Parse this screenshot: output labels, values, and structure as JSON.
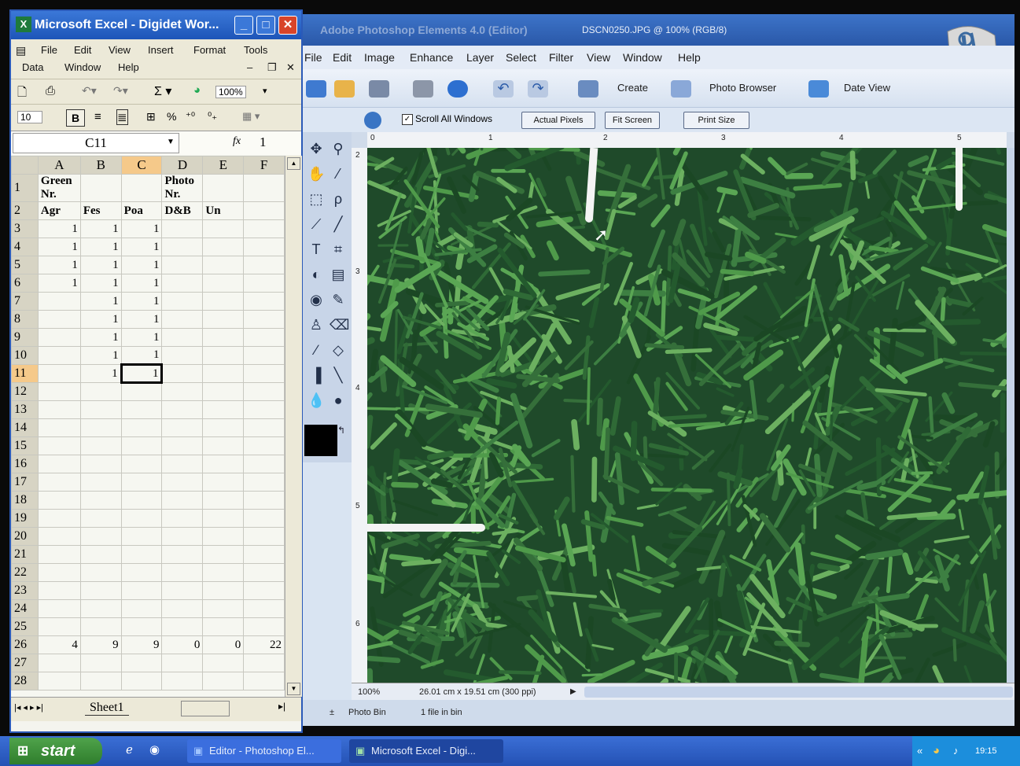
{
  "photoshop": {
    "title": "Adobe Photoshop Elements 4.0 (Editor)",
    "document_title": "DSCN0250.JPG @ 100% (RGB/8)",
    "menu": [
      "File",
      "Edit",
      "Image",
      "Enhance",
      "Layer",
      "Select",
      "Filter",
      "View",
      "Window",
      "Help"
    ],
    "toolbar": {
      "create_label": "Create",
      "photo_browser_label": "Photo Browser",
      "date_view_label": "Date View"
    },
    "options": {
      "scroll_all_label": "Scroll All Windows",
      "actual_pixels_label": "Actual Pixels",
      "fit_screen_label": "Fit Screen",
      "print_size_label": "Print Size"
    },
    "ruler_top": [
      "0",
      "1",
      "2",
      "3",
      "4",
      "5"
    ],
    "ruler_left": [
      "2",
      "3",
      "4",
      "5",
      "6"
    ],
    "status": {
      "zoom": "100%",
      "doc_size": "26.01 cm x 19.51 cm (300 ppi)"
    },
    "photo_bin": {
      "label": "Photo Bin",
      "info": "1 file in bin"
    }
  },
  "excel": {
    "title": "Microsoft Excel - Digidet Wor...",
    "menu_row1": [
      "File",
      "Edit",
      "View",
      "Insert",
      "Format",
      "Tools"
    ],
    "menu_row2": [
      "Data",
      "Window",
      "Help"
    ],
    "zoom": "100%",
    "font_size": "10",
    "name_box": "C11",
    "fx_label": "fx",
    "formula_value": "1",
    "columns": [
      "A",
      "B",
      "C",
      "D",
      "E",
      "F"
    ],
    "rows": [
      [
        "1",
        "Green Nr.",
        "",
        "",
        "Photo Nr.",
        "",
        ""
      ],
      [
        "2",
        "Agr",
        "Fes",
        "Poa",
        "D&B",
        "Un",
        ""
      ],
      [
        "3",
        "1",
        "1",
        "1",
        "",
        "",
        ""
      ],
      [
        "4",
        "1",
        "1",
        "1",
        "",
        "",
        ""
      ],
      [
        "5",
        "1",
        "1",
        "1",
        "",
        "",
        ""
      ],
      [
        "6",
        "1",
        "1",
        "1",
        "",
        "",
        ""
      ],
      [
        "7",
        "",
        "1",
        "1",
        "",
        "",
        ""
      ],
      [
        "8",
        "",
        "1",
        "1",
        "",
        "",
        ""
      ],
      [
        "9",
        "",
        "1",
        "1",
        "",
        "",
        ""
      ],
      [
        "10",
        "",
        "1",
        "1",
        "",
        "",
        ""
      ],
      [
        "11",
        "",
        "1",
        "1",
        "",
        "",
        ""
      ],
      [
        "12",
        "",
        "",
        "",
        "",
        "",
        ""
      ],
      [
        "13",
        "",
        "",
        "",
        "",
        "",
        ""
      ],
      [
        "14",
        "",
        "",
        "",
        "",
        "",
        ""
      ],
      [
        "15",
        "",
        "",
        "",
        "",
        "",
        ""
      ],
      [
        "16",
        "",
        "",
        "",
        "",
        "",
        ""
      ],
      [
        "17",
        "",
        "",
        "",
        "",
        "",
        ""
      ],
      [
        "18",
        "",
        "",
        "",
        "",
        "",
        ""
      ],
      [
        "19",
        "",
        "",
        "",
        "",
        "",
        ""
      ],
      [
        "20",
        "",
        "",
        "",
        "",
        "",
        ""
      ],
      [
        "21",
        "",
        "",
        "",
        "",
        "",
        ""
      ],
      [
        "22",
        "",
        "",
        "",
        "",
        "",
        ""
      ],
      [
        "23",
        "",
        "",
        "",
        "",
        "",
        ""
      ],
      [
        "24",
        "",
        "",
        "",
        "",
        "",
        ""
      ],
      [
        "25",
        "",
        "",
        "",
        "",
        "",
        ""
      ],
      [
        "26",
        "4",
        "9",
        "9",
        "0",
        "0",
        "22"
      ],
      [
        "27",
        "",
        "",
        "",
        "",
        "",
        ""
      ],
      [
        "28",
        "",
        "",
        "",
        "",
        "",
        ""
      ]
    ],
    "sheet_tab": "Sheet1"
  },
  "taskbar": {
    "start_label": "start",
    "tasks": [
      "Editor - Photoshop El...",
      "Microsoft Excel - Digi..."
    ],
    "clock": "19:15"
  },
  "colors": {
    "xp_blue": "#2451b4",
    "start_green": "#2f7d2c",
    "grass_dark": "#1f4a2a",
    "grass_light": "#4f9a4a"
  }
}
